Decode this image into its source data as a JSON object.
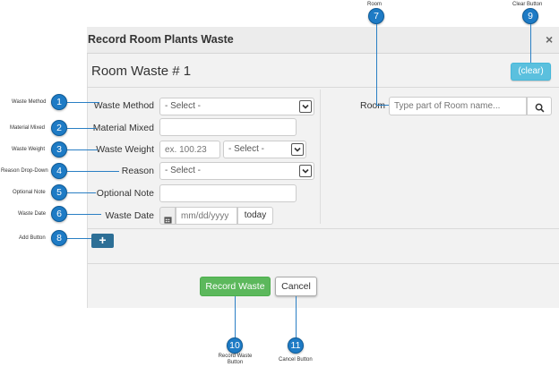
{
  "dialog": {
    "title": "Record Room Plants Waste",
    "close": "×",
    "heading": "Room Waste # 1"
  },
  "form": {
    "waste_method": {
      "label": "Waste Method",
      "value": "- Select -"
    },
    "material_mixed": {
      "label": "Material Mixed",
      "value": ""
    },
    "waste_weight": {
      "label": "Waste Weight",
      "placeholder": "ex. 100.23",
      "unit_value": "- Select -"
    },
    "reason": {
      "label": "Reason",
      "value": "- Select -"
    },
    "optional_note": {
      "label": "Optional Note",
      "value": ""
    },
    "waste_date": {
      "label": "Waste Date",
      "placeholder": "mm/dd/yyyy",
      "today_label": "today"
    },
    "room": {
      "label": "Room",
      "placeholder": "Type part of Room name..."
    }
  },
  "buttons": {
    "clear": "(clear)",
    "add": "+",
    "record": "Record Waste",
    "cancel": "Cancel"
  },
  "annotations": {
    "1": {
      "num": "1",
      "text": "Waste Method"
    },
    "2": {
      "num": "2",
      "text": "Material Mixed"
    },
    "3": {
      "num": "3",
      "text": "Waste Weight"
    },
    "4": {
      "num": "4",
      "text": "Reason Drop-Down"
    },
    "5": {
      "num": "5",
      "text": "Optional Note"
    },
    "6": {
      "num": "6",
      "text": "Waste Date"
    },
    "7": {
      "num": "7",
      "text": "Room"
    },
    "8": {
      "num": "8",
      "text": "Add Button"
    },
    "9": {
      "num": "9",
      "text": "Clear Button"
    },
    "10": {
      "num": "10",
      "text": "Record Waste Button"
    },
    "11": {
      "num": "11",
      "text": "Cancel Button"
    }
  },
  "colors": {
    "accent": "#1e7bc5",
    "record": "#5cb85c",
    "clear": "#5bc0de",
    "add": "#2d6f96"
  },
  "icons": {
    "search": "search-icon",
    "calendar": "calendar-icon",
    "close": "close-icon",
    "plus": "plus-icon"
  }
}
